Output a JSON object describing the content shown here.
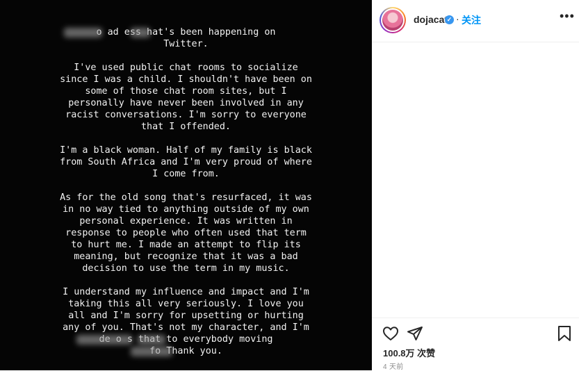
{
  "post": {
    "paragraphs": [
      "o ad  ess  hat's been happening on\nTwitter.",
      "I've used public chat rooms to socialize\nsince I was a child. I shouldn't have been on\nsome of those chat room sites, but I\npersonally have never been involved in any\nracist conversations. I'm sorry to everyone\nthat I offended.",
      "I'm a black woman. Half of my family is black\nfrom South Africa and I'm very proud of where\nI come from.",
      "As for the old song that's resurfaced, it was\nin no way tied to anything outside of my own\npersonal experience. It was written in\nresponse to people who often used that term\nto hurt me. I made an attempt to flip its\nmeaning, but recognize that it was a bad\ndecision to use the term in my music.",
      "I understand my influence and impact and I'm\ntaking this all very seriously. I love you\nall and I'm sorry for upsetting or hurting\nany of you. That's not my character, and I'm\nde        o s     that to everybody moving\nfo         Thank you."
    ]
  },
  "header": {
    "username": "dojacat",
    "verified_mark": "✓",
    "separator": "·",
    "follow_label": "关注",
    "more_label": "•••"
  },
  "actions": {
    "icons": [
      "heart-icon",
      "share-icon",
      "bookmark-icon"
    ],
    "likes": "100.8万 次赞",
    "time": "4 天前"
  }
}
